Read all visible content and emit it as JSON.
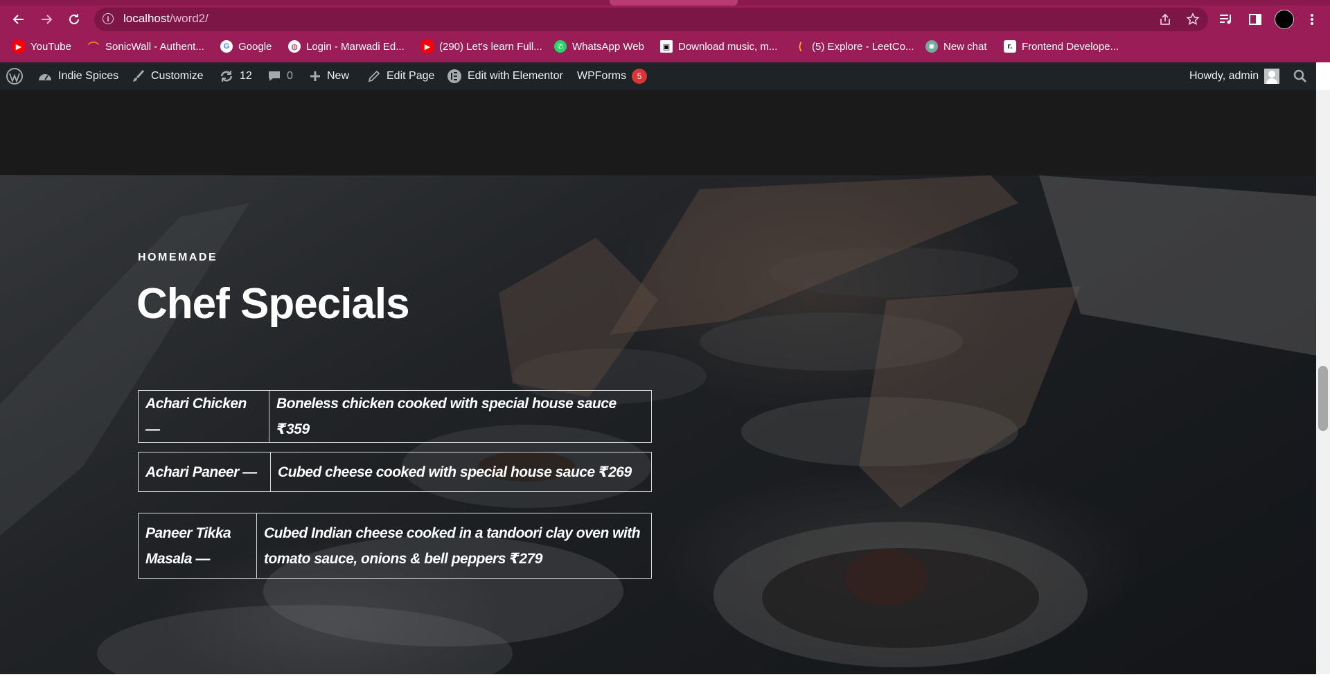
{
  "browser": {
    "url_host": "localhost",
    "url_path": "/word2/",
    "bookmarks": [
      {
        "label": "YouTube",
        "icon": "youtube-icon"
      },
      {
        "label": "SonicWall - Authent...",
        "icon": "sonicwall-icon"
      },
      {
        "label": "Google",
        "icon": "google-icon"
      },
      {
        "label": "Login - Marwadi Ed...",
        "icon": "globe-icon"
      },
      {
        "label": "(290) Let's learn Full...",
        "icon": "youtube-icon"
      },
      {
        "label": "WhatsApp Web",
        "icon": "whatsapp-icon"
      },
      {
        "label": "Download music, m...",
        "icon": "download-icon"
      },
      {
        "label": "(5) Explore - LeetCo...",
        "icon": "leetcode-icon"
      },
      {
        "label": "New chat",
        "icon": "chatgpt-icon"
      },
      {
        "label": "Frontend Develope...",
        "icon": "frontend-icon"
      }
    ]
  },
  "adminbar": {
    "site_name": "Indie Spices",
    "customize": "Customize",
    "updates_count": "12",
    "comments_count": "0",
    "new_label": "New",
    "edit_page": "Edit Page",
    "edit_elementor": "Edit with Elementor",
    "wpforms": "WPForms",
    "wpforms_badge": "5",
    "howdy": "Howdy, admin"
  },
  "hero": {
    "eyebrow": "HOMEMADE",
    "title": "Chef Specials",
    "items": [
      {
        "name": "Achari Chicken —",
        "description": "Boneless chicken cooked with special house sauce ₹359"
      },
      {
        "name": "Achari Paneer —",
        "description": "Cubed cheese cooked with special house sauce ₹269"
      },
      {
        "name": "Paneer Tikka Masala —",
        "description": "Cubed Indian cheese cooked in a tandoori clay oven with tomato sauce, onions & bell peppers ₹279"
      }
    ]
  },
  "colors": {
    "chrome": "#9a1d57",
    "adminbar": "#1d2327",
    "page_bg": "#1a1a1a",
    "badge": "#d63638"
  }
}
